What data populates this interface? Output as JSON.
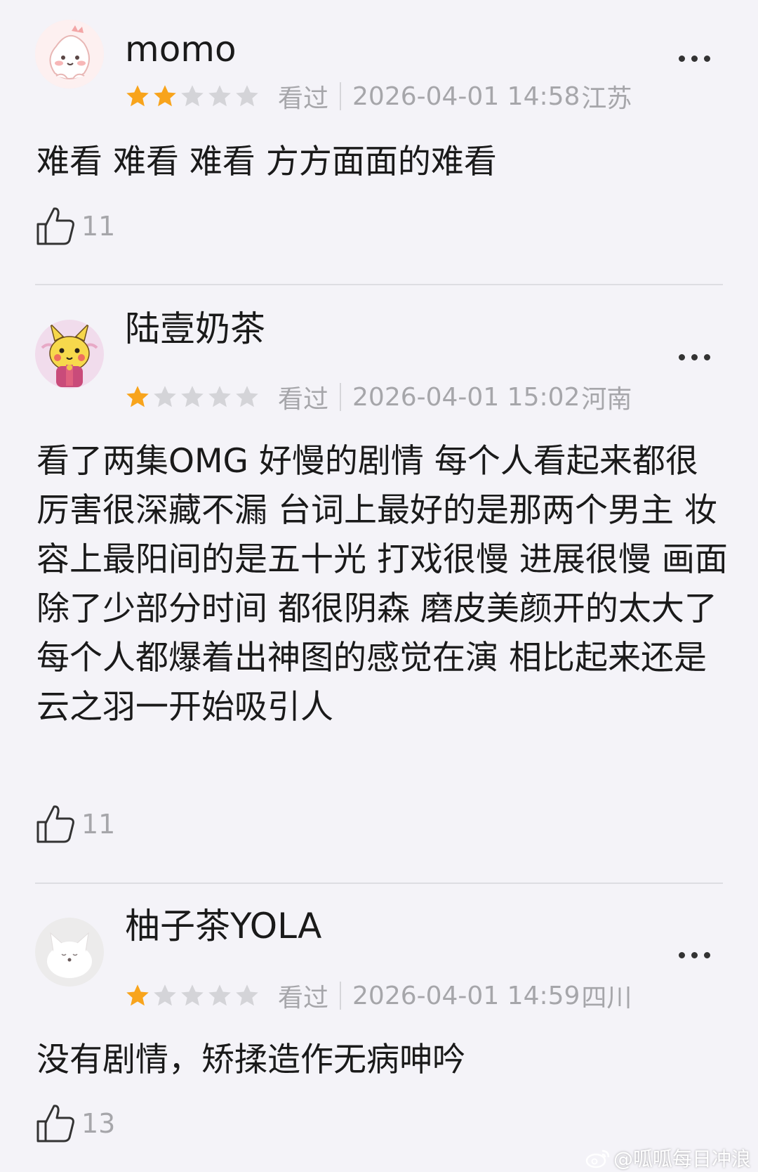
{
  "reviews": [
    {
      "username": "momo",
      "rating": 2,
      "status": "看过",
      "time": "2026-04-01 14:58",
      "region": "江苏",
      "content": "难看 难看 难看 方方面面的难看",
      "likes": "11",
      "avatar_icon": "dragon-cartoon-avatar"
    },
    {
      "username": "陆壹奶茶",
      "rating": 1,
      "status": "看过",
      "time": "2026-04-01 15:02",
      "region": "河南",
      "content": "看了两集OMG 好慢的剧情 每个人看起来都很厉害很深藏不漏 台词上最好的是那两个男主 妆容上最阳间的是五十光 打戏很慢 进展很慢 画面除了少部分时间 都很阴森 磨皮美颜开的太大了每个人都爆着出神图的感觉在演 相比起来还是云之羽一开始吸引人",
      "likes": "11",
      "avatar_icon": "pikachu-avatar"
    },
    {
      "username": "柚子茶YOLA",
      "rating": 1,
      "status": "看过",
      "time": "2026-04-01 14:59",
      "region": "四川",
      "content": "没有剧情，矫揉造作无病呻吟",
      "likes": "13",
      "avatar_icon": "white-fox-avatar"
    }
  ],
  "watermark": "@呱呱每日冲浪",
  "colors": {
    "star_on": "#f8a41c",
    "star_off": "#d4d4d8",
    "background": "#f4f3f8",
    "meta_text": "#a6a6aa"
  }
}
